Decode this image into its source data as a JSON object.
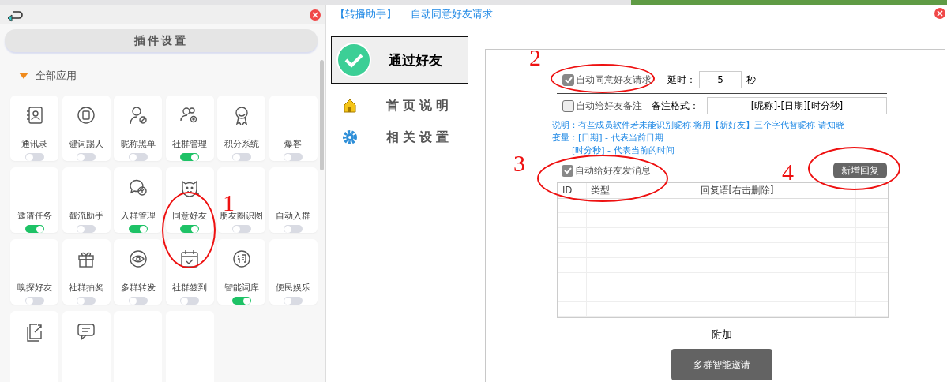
{
  "plugin_panel": {
    "settings_button": "插件设置",
    "section": {
      "label": "全部应用",
      "expanded": true
    },
    "apps": [
      {
        "name": "通讯录",
        "on": false
      },
      {
        "name": "键词踢人",
        "on": false
      },
      {
        "name": "昵称黑单",
        "on": false
      },
      {
        "name": "社群管理",
        "on": true
      },
      {
        "name": "积分系统",
        "on": false
      },
      {
        "name": "爆客",
        "on": false
      },
      {
        "name": "邀请任务",
        "on": true
      },
      {
        "name": "截流助手",
        "on": false
      },
      {
        "name": "入群管理",
        "on": true
      },
      {
        "name": "同意好友",
        "on": true
      },
      {
        "name": "朋友圈识图",
        "on": false
      },
      {
        "name": "自动入群",
        "on": false
      },
      {
        "name": "嗅探好友",
        "on": false
      },
      {
        "name": "社群抽奖",
        "on": false
      },
      {
        "name": "多群转发",
        "on": false
      },
      {
        "name": "社群签到",
        "on": false
      },
      {
        "name": "智能词库",
        "on": true
      },
      {
        "name": "便民娱乐",
        "on": false
      },
      {
        "kind": "cut"
      },
      {
        "kind": "cut"
      },
      {
        "kind": "cut"
      },
      {
        "kind": "cut"
      }
    ]
  },
  "dialog": {
    "title_tag": "【转播助手】",
    "title": "自动同意好友请求",
    "nav": [
      {
        "label": "通过好友",
        "selected": true
      },
      {
        "label": "首页说明",
        "selected": false
      },
      {
        "label": "相关设置",
        "selected": false
      }
    ],
    "auto_accept": {
      "label": "自动同意好友请求",
      "checked": true,
      "delay_label": "延时：",
      "delay": "5",
      "unit": "秒"
    },
    "auto_remark": {
      "label": "自动给好友备注",
      "checked": false,
      "format_label": "备注格式：",
      "format": "[昵称]-[日期][时分秒]"
    },
    "notes": [
      "说明：有些成员软件若未能识别昵称 将用【新好友】三个字代替昵称 请知晓",
      "变量：[日期] - 代表当前日期",
      "[时分秒] - 代表当前的时间"
    ],
    "auto_message": {
      "label": "自动给好友发消息",
      "checked": true
    },
    "add_reply_button": "新增回复",
    "table": {
      "columns": [
        "ID",
        "类型",
        "回复语[右击删除]"
      ]
    },
    "extra_label": "--------附加--------",
    "invite_button": "多群智能邀请"
  },
  "annotations": [
    {
      "label": "1"
    },
    {
      "label": "2"
    },
    {
      "label": "3"
    },
    {
      "label": "4"
    }
  ]
}
